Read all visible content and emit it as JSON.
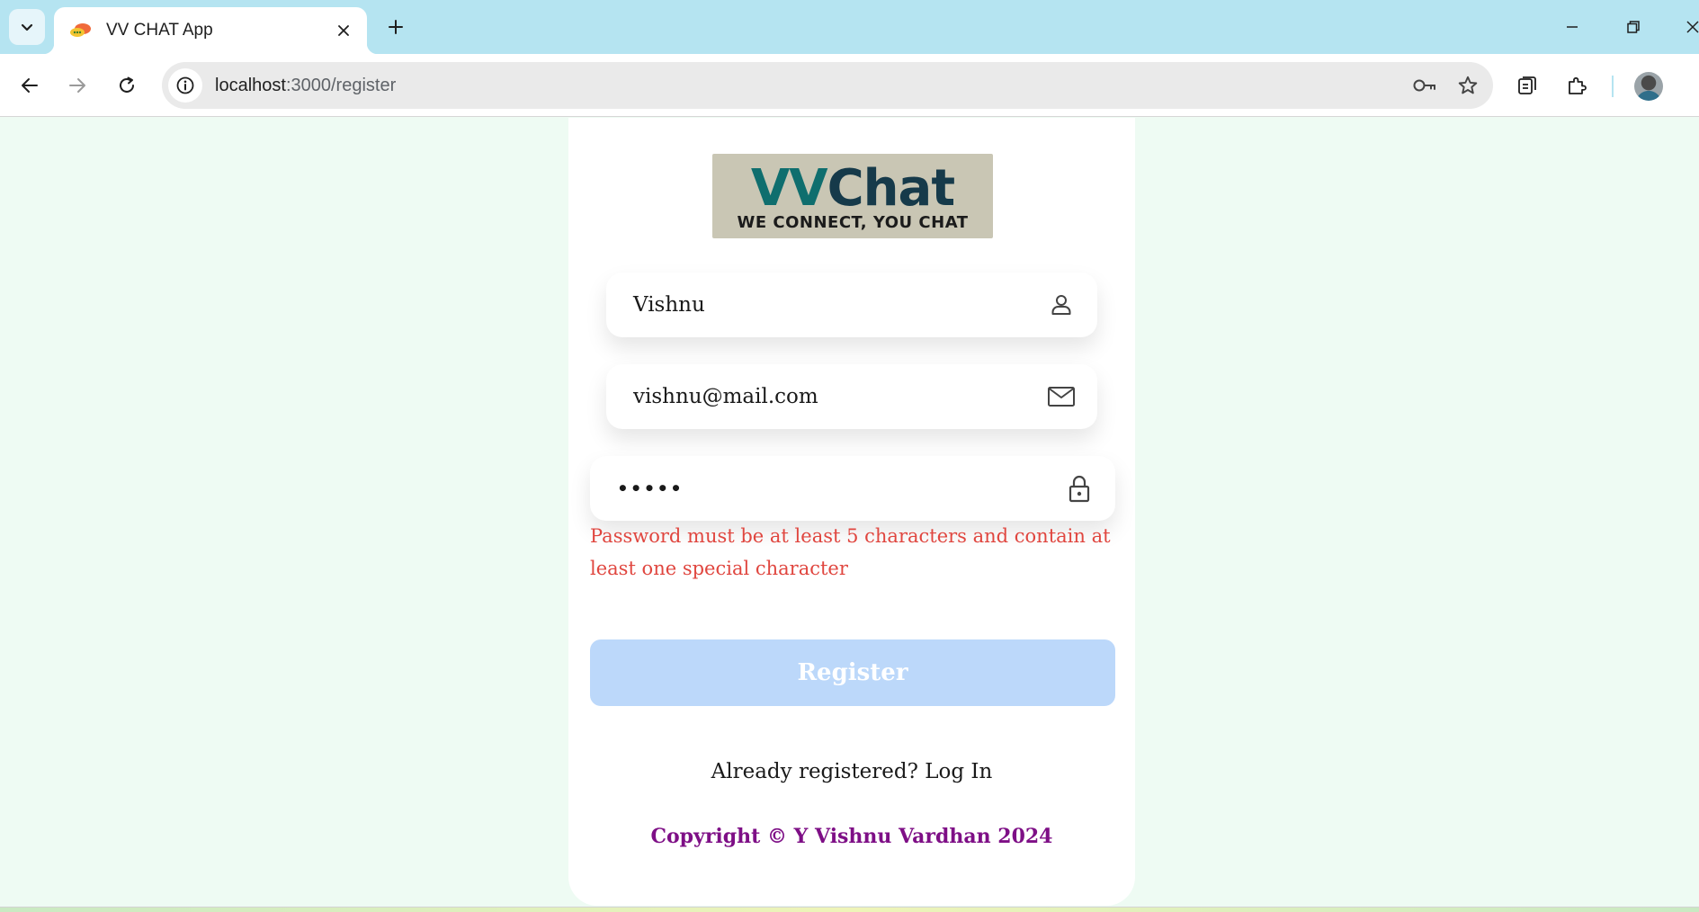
{
  "browser": {
    "tab_title": "VV CHAT App",
    "url_host": "localhost",
    "url_path": ":3000/register",
    "icons": [
      "tab-search-icon",
      "close-icon",
      "plus-icon",
      "minimize-icon",
      "restore-icon",
      "window-close-icon",
      "back-arrow-icon",
      "forward-arrow-icon",
      "reload-icon",
      "info-icon",
      "key-icon",
      "star-icon",
      "reading-list-icon",
      "extensions-icon",
      "profile-avatar"
    ]
  },
  "logo": {
    "main_vv": "VV",
    "main_chat": "Chat",
    "tagline": "WE CONNECT, YOU CHAT"
  },
  "form": {
    "name_value": "Vishnu",
    "email_value": "vishnu@mail.com",
    "password_mask": "•••••",
    "error_message": "Password must be at least 5 characters and contain at least one special character",
    "register_label": "Register",
    "already_text": "Already registered? ",
    "login_link": "Log In",
    "copyright": "Copyright © Y Vishnu Vardhan 2024"
  },
  "colors": {
    "page_bg": "#eefbf3",
    "tabbar_bg": "#b5e4f1",
    "error": "#e0463f",
    "register_disabled": "#bcd8fa",
    "copyright": "#7e0f86"
  }
}
